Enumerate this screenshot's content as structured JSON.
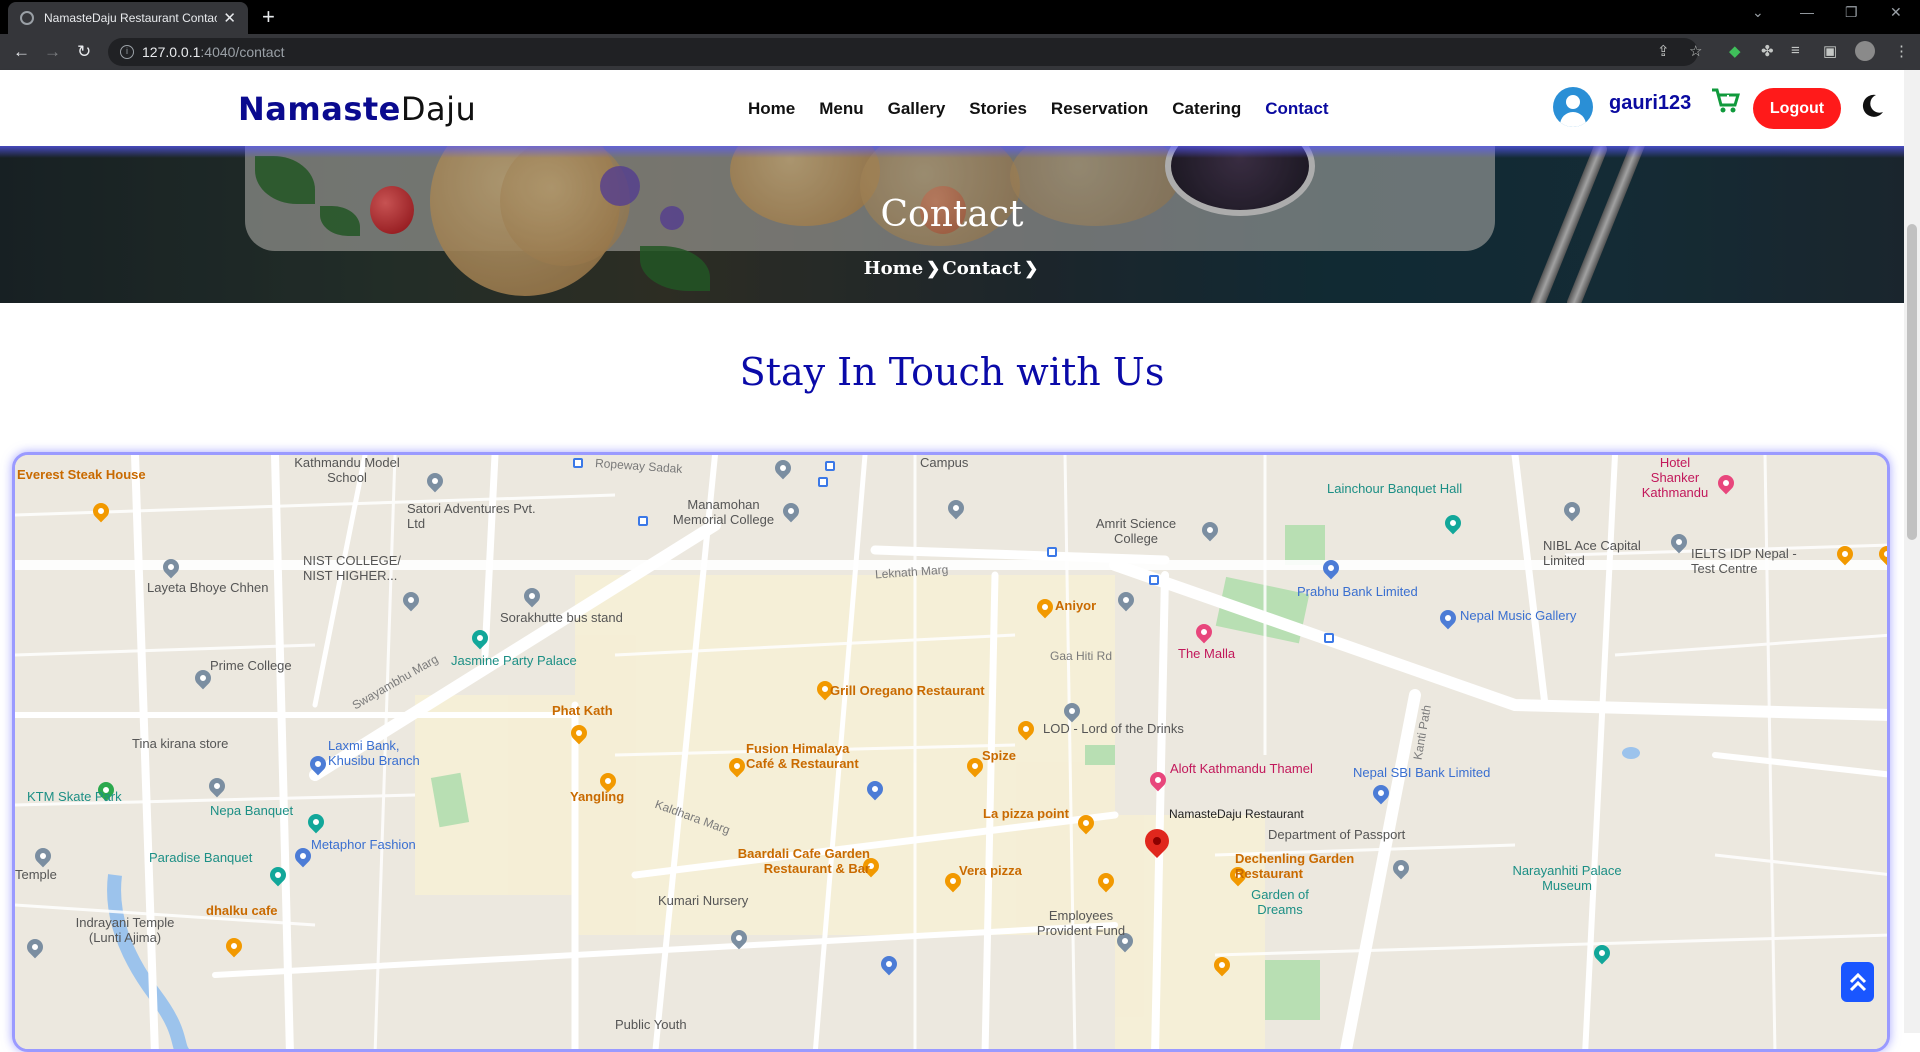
{
  "browser": {
    "tab_title": "NamasteDaju Restaurant Contact",
    "url_host": "127.0.0.1",
    "url_path": ":4040/contact"
  },
  "site": {
    "logo_part1": "Namaste",
    "logo_part2": "Daju",
    "nav": [
      "Home",
      "Menu",
      "Gallery",
      "Stories",
      "Reservation",
      "Catering",
      "Contact"
    ],
    "active_nav": "Contact",
    "username": "gauri123",
    "logout_label": "Logout"
  },
  "hero": {
    "title": "Contact",
    "crumb_home": "Home",
    "crumb_current": "Contact"
  },
  "section": {
    "title": "Stay In Touch with Us"
  },
  "map": {
    "labels": [
      {
        "text": "Everest Steak House",
        "cls": "orange"
      },
      {
        "text": "Kathmandu Model School",
        "cls": ""
      },
      {
        "text": "Satori Adventures Pvt. Ltd",
        "cls": ""
      },
      {
        "text": "Manamohan Memorial College",
        "cls": ""
      },
      {
        "text": "Campus",
        "cls": ""
      },
      {
        "text": "Amrit Science College",
        "cls": ""
      },
      {
        "text": "Lainchour Banquet Hall",
        "cls": "teal"
      },
      {
        "text": "Hotel Shanker Kathmandu",
        "cls": "pink"
      },
      {
        "text": "NIBL Ace Capital Limited",
        "cls": ""
      },
      {
        "text": "IELTS IDP Nepal - Test Centre",
        "cls": ""
      },
      {
        "text": "Layeta Bhoye Chhen",
        "cls": ""
      },
      {
        "text": "NIST COLLEGE/ NIST HIGHER...",
        "cls": ""
      },
      {
        "text": "Sorakhutte bus stand",
        "cls": ""
      },
      {
        "text": "Leknath Marg",
        "cls": "street"
      },
      {
        "text": "Aniyor",
        "cls": "orange"
      },
      {
        "text": "Prabhu Bank Limited",
        "cls": "blue"
      },
      {
        "text": "Nepal Music Gallery",
        "cls": "blue"
      },
      {
        "text": "Jasmine Party Palace",
        "cls": "teal"
      },
      {
        "text": "Prime College",
        "cls": ""
      },
      {
        "text": "The Malla",
        "cls": "pink"
      },
      {
        "text": "Grill Oregano Restaurant",
        "cls": "orange"
      },
      {
        "text": "Phat Kath",
        "cls": "orange"
      },
      {
        "text": "LOD - Lord of the Drinks",
        "cls": ""
      },
      {
        "text": "Tina kirana store",
        "cls": ""
      },
      {
        "text": "Laxmi Bank, Khusibu Branch",
        "cls": "blue"
      },
      {
        "text": "Fusion Himalaya Café & Restaurant",
        "cls": "orange"
      },
      {
        "text": "Spize",
        "cls": "orange"
      },
      {
        "text": "Aloft Kathmandu Thamel",
        "cls": "pink"
      },
      {
        "text": "Nepal SBI Bank Limited",
        "cls": "blue"
      },
      {
        "text": "KTM Skate Park",
        "cls": "teal"
      },
      {
        "text": "Yangling",
        "cls": "orange"
      },
      {
        "text": "Nepa Banquet",
        "cls": "teal"
      },
      {
        "text": "La pizza point",
        "cls": "orange"
      },
      {
        "text": "NamasteDaju Restaurant",
        "cls": ""
      },
      {
        "text": "Metaphor Fashion",
        "cls": "blue"
      },
      {
        "text": "Department of Passport",
        "cls": ""
      },
      {
        "text": "Paradise Banquet",
        "cls": "teal"
      },
      {
        "text": "Baardali Cafe Garden Restaurant & Bar",
        "cls": "orange"
      },
      {
        "text": "Vera pizza",
        "cls": "orange"
      },
      {
        "text": "Dechenling Garden Restaurant",
        "cls": "orange"
      },
      {
        "text": "Garden of Dreams",
        "cls": "teal"
      },
      {
        "text": "Narayanhiti Palace Museum",
        "cls": "teal"
      },
      {
        "text": "Temple",
        "cls": ""
      },
      {
        "text": "dhalku cafe",
        "cls": "orange"
      },
      {
        "text": "Kumari Nursery",
        "cls": ""
      },
      {
        "text": "Employees Provident Fund",
        "cls": ""
      },
      {
        "text": "Indrayani Temple (Lunti Ajima)",
        "cls": ""
      },
      {
        "text": "Public Youth",
        "cls": ""
      },
      {
        "text": "Ropeway Sadak",
        "cls": "street"
      },
      {
        "text": "Swayambhu Marg",
        "cls": "street"
      },
      {
        "text": "Kanti Path",
        "cls": "street"
      },
      {
        "text": "Kaldhara Marg",
        "cls": "street"
      },
      {
        "text": "Gaa Hiti Rd",
        "cls": "street"
      }
    ]
  }
}
